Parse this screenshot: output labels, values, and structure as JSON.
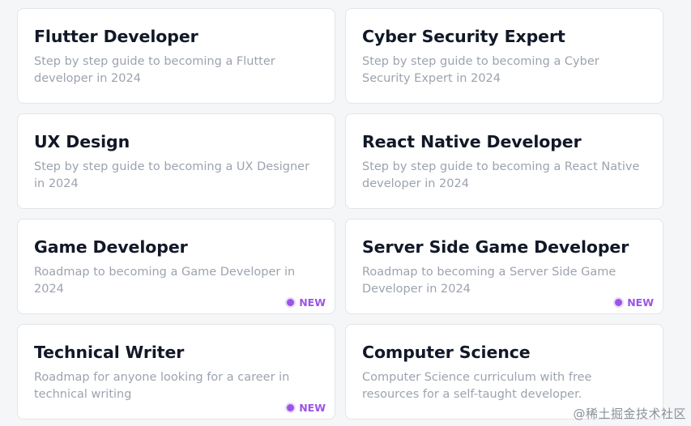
{
  "cards": [
    {
      "title": "Flutter Developer",
      "description": "Step by step guide to becoming a Flutter developer in 2024",
      "badge": ""
    },
    {
      "title": "Cyber Security Expert",
      "description": "Step by step guide to becoming a Cyber Security Expert in 2024",
      "badge": ""
    },
    {
      "title": "UX Design",
      "description": "Step by step guide to becoming a UX Designer in 2024",
      "badge": ""
    },
    {
      "title": "React Native Developer",
      "description": "Step by step guide to becoming a React Native developer in 2024",
      "badge": ""
    },
    {
      "title": "Game Developer",
      "description": "Roadmap to becoming a Game Developer in 2024",
      "badge": "NEW"
    },
    {
      "title": "Server Side Game Developer",
      "description": "Roadmap to becoming a Server Side Game Developer in 2024",
      "badge": "NEW"
    },
    {
      "title": "Technical Writer",
      "description": "Roadmap for anyone looking for a career in technical writing",
      "badge": "NEW"
    },
    {
      "title": "Computer Science",
      "description": "Computer Science curriculum with free resources for a self-taught developer.",
      "badge": ""
    }
  ],
  "watermark": "@稀土掘金技术社区",
  "colors": {
    "background": "#f5f6f8",
    "card": "#ffffff",
    "title": "#111827",
    "description": "#9ca3af",
    "badge": "#9b54e6"
  }
}
